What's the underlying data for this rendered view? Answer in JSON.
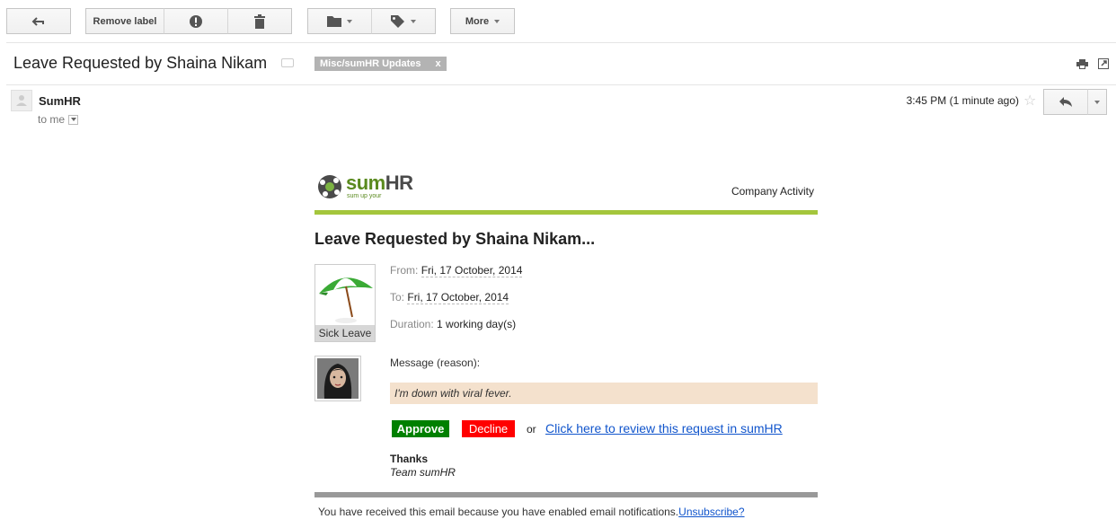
{
  "toolbar": {
    "remove_label": "Remove label",
    "more_label": "More"
  },
  "header": {
    "subject": "Leave Requested by Shaina Nikam",
    "label_chip": "Misc/sumHR Updates",
    "label_chip_close": "x"
  },
  "message": {
    "sender": "SumHR",
    "recipient": "to me",
    "timestamp": "3:45 PM (1 minute ago)"
  },
  "email": {
    "logo_sum": "sum",
    "logo_hr": "HR",
    "logo_tagline": "sum up your",
    "company_activity": "Company Activity",
    "title": "Leave Requested by Shaina Nikam...",
    "leave_type": "Sick Leave",
    "from_label": "From:",
    "from_value": "Fri, 17 October, 2014",
    "to_label": "To:",
    "to_value": "Fri, 17 October, 2014",
    "duration_label": "Duration:",
    "duration_value": "1 working day(s)",
    "message_label": "Message (reason):",
    "message_text": "I'm down with viral fever.",
    "approve": "Approve",
    "decline": "Decline",
    "or": "or",
    "review_link": "Click here to review this request in sumHR",
    "thanks": "Thanks",
    "team": "Team sumHR",
    "footer_text": "You have received this email because you have enabled email notifications.",
    "unsubscribe": "Unsubscribe?"
  },
  "colors": {
    "approve": "#008000",
    "decline": "#ff0000",
    "brand_green": "#a4c63c",
    "link": "#1155cc",
    "message_bg": "#f4e1cd"
  }
}
